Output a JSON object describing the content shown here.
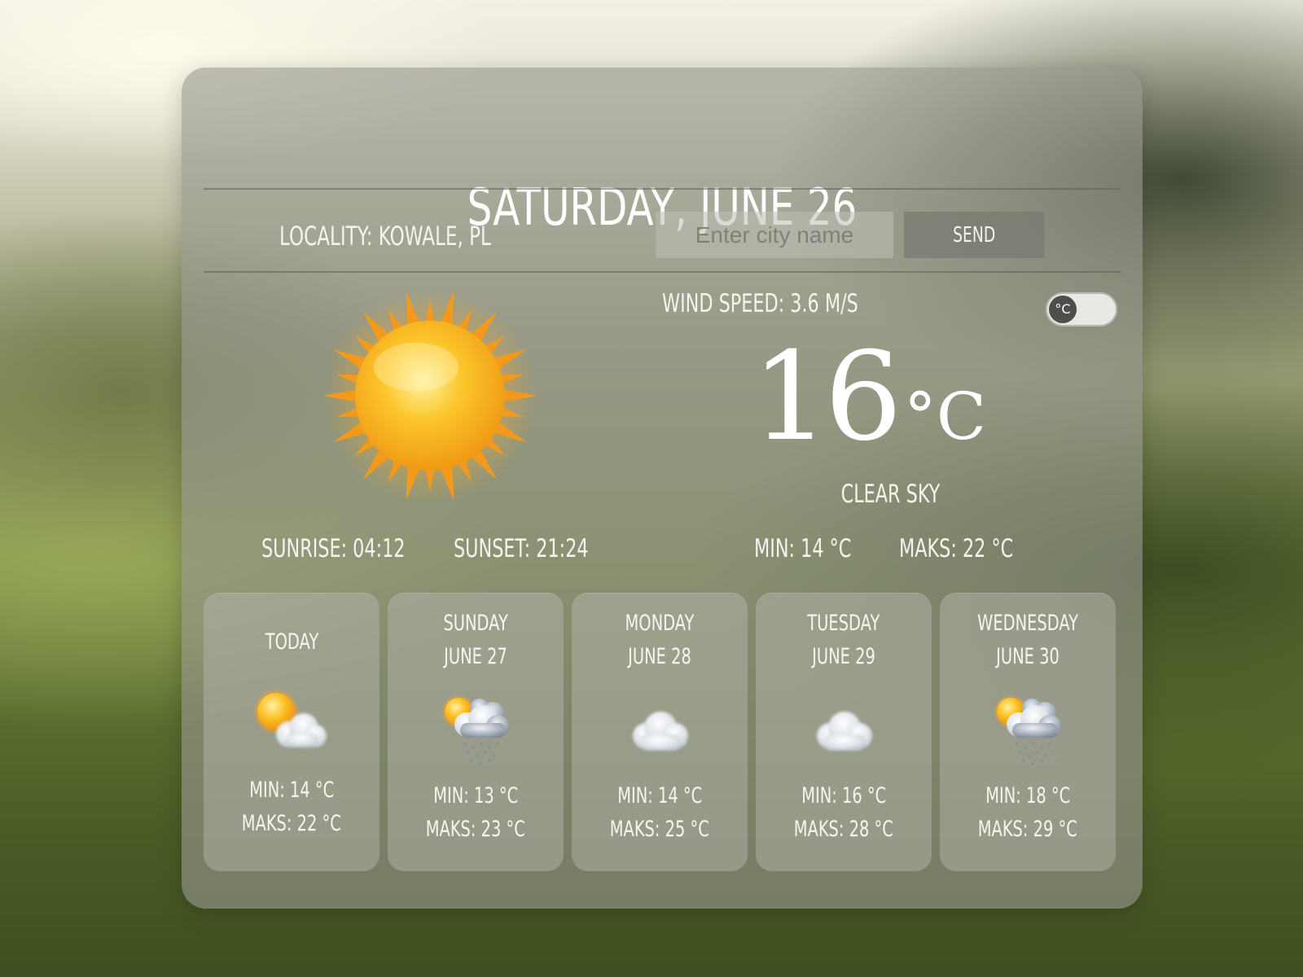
{
  "header": {
    "date": "SATURDAY, JUNE 26"
  },
  "search": {
    "locality_label": "LOCALITY: KOWALE, PL",
    "placeholder": "Enter city name",
    "value": "",
    "send_label": "SEND"
  },
  "current": {
    "wind_speed": "WIND SPEED: 3.6 M/S",
    "unit_toggle": "°C",
    "temperature": "16",
    "temperature_unit": "°C",
    "description": "CLEAR SKY",
    "sunrise": "SUNRISE: 04:12",
    "sunset": "SUNSET: 21:24",
    "min": "MIN: 14 °C",
    "max": "MAKS: 22 °C",
    "icon": "sun-icon"
  },
  "forecast": [
    {
      "day": "TODAY",
      "date": "",
      "icon": "partly-cloudy-icon",
      "min": "MIN: 14 °C",
      "max": "MAKS: 22 °C"
    },
    {
      "day": "SUNDAY",
      "date": "JUNE 27",
      "icon": "sun-cloud-rain-icon",
      "min": "MIN: 13 °C",
      "max": "MAKS: 23 °C"
    },
    {
      "day": "MONDAY",
      "date": "JUNE 28",
      "icon": "cloud-icon",
      "min": "MIN: 14 °C",
      "max": "MAKS: 25 °C"
    },
    {
      "day": "TUESDAY",
      "date": "JUNE 29",
      "icon": "cloud-icon",
      "min": "MIN: 16 °C",
      "max": "MAKS: 28 °C"
    },
    {
      "day": "WEDNESDAY",
      "date": "JUNE 30",
      "icon": "sun-cloud-rain-icon",
      "min": "MIN: 18 °C",
      "max": "MAKS: 29 °C"
    }
  ],
  "colors": {
    "card": "#96968e",
    "text": "#ffffff",
    "sun_core": "#fbb81e",
    "sun_rays": "#f39419"
  }
}
